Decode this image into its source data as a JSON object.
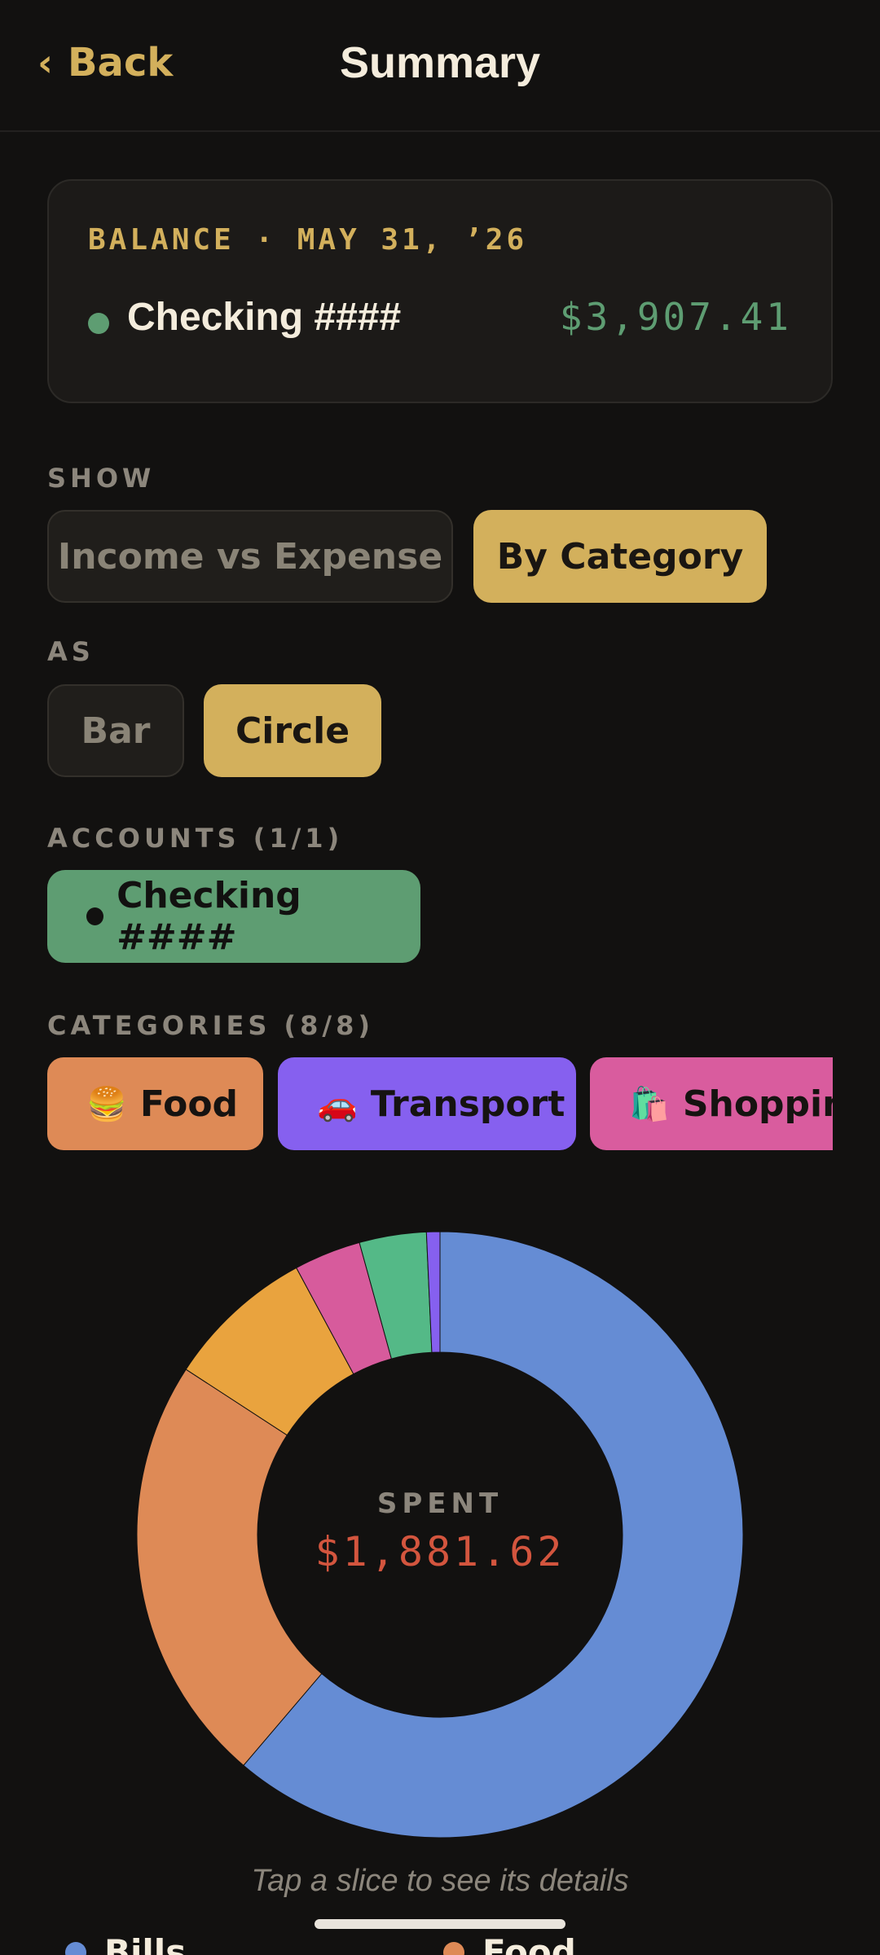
{
  "header": {
    "back_label": "Back",
    "title": "Summary"
  },
  "balance": {
    "label": "BALANCE · MAY 31, ’26",
    "account_name": "Checking ####",
    "amount": "$3,907.41",
    "dot_color": "#5e9d72"
  },
  "show": {
    "label": "SHOW",
    "options": [
      {
        "label": "Income vs Expense",
        "selected": false
      },
      {
        "label": "By Category",
        "selected": true
      }
    ]
  },
  "as": {
    "label": "AS",
    "options": [
      {
        "label": "Bar",
        "selected": false
      },
      {
        "label": "Circle",
        "selected": true
      }
    ]
  },
  "accounts": {
    "label": "ACCOUNTS (1/1)",
    "items": [
      {
        "label": "Checking ####",
        "color": "#5e9d72"
      }
    ]
  },
  "categories": {
    "label": "CATEGORIES (8/8)",
    "items": [
      {
        "emoji": "🍔",
        "label": "Food",
        "color": "#de8a56"
      },
      {
        "emoji": "🚗",
        "label": "Transport",
        "color": "#8660ef"
      },
      {
        "emoji": "🛍️",
        "label": "Shopping",
        "color": "#d95c9e"
      }
    ]
  },
  "chart_data": {
    "type": "pie",
    "values": [
      60.0,
      22.5,
      7.8,
      3.5,
      3.5,
      0.7
    ],
    "colors": [
      "#658cd4",
      "#de8a56",
      "#e9a33e",
      "#d75b9c",
      "#54b987",
      "#8660ef"
    ]
  },
  "summary": {
    "spent_label": "SPENT",
    "spent_amount": "$1,881.62",
    "hint": "Tap a slice to see its details"
  },
  "legend": {
    "items": [
      {
        "label": "Bills",
        "color": "#658cd4"
      },
      {
        "label": "Food",
        "color": "#de8a56"
      }
    ]
  }
}
